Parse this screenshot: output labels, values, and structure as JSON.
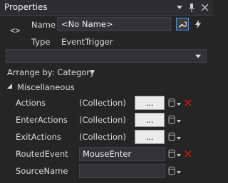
{
  "panel": {
    "title": "Properties",
    "dropdown_icon": "chevron-down-icon",
    "pin_icon": "pin-icon",
    "close_icon": "close-icon"
  },
  "object": {
    "icon": "xaml-element-icon",
    "icon_glyph": "<>",
    "name_label": "Name",
    "name_value": "<No Name>",
    "type_label": "Type",
    "type_value": "EventTrigger",
    "properties_view_icon": "wrench-icon",
    "events_view_icon": "lightning-icon"
  },
  "search": {
    "value": "",
    "button_icon": "chevron-down-icon"
  },
  "arrange": {
    "label": "Arrange by: Category"
  },
  "category": {
    "label": "Miscellaneous",
    "expanded": true,
    "properties": [
      {
        "name": "Actions",
        "value": "(Collection)",
        "editor": "collection",
        "button": "...",
        "has_reset": true
      },
      {
        "name": "EnterActions",
        "value": "(Collection)",
        "editor": "collection",
        "button": "...",
        "has_reset": false
      },
      {
        "name": "ExitActions",
        "value": "(Collection)",
        "editor": "collection",
        "button": "...",
        "has_reset": false
      },
      {
        "name": "RoutedEvent",
        "value": "MouseEnter",
        "editor": "text",
        "button": "",
        "has_reset": true
      },
      {
        "name": "SourceName",
        "value": "",
        "editor": "text",
        "button": "",
        "has_reset": false
      }
    ]
  },
  "colors": {
    "background": "#252526",
    "accent": "#3399ff",
    "reset": "#e51400",
    "button_face": "#ebebeb"
  }
}
